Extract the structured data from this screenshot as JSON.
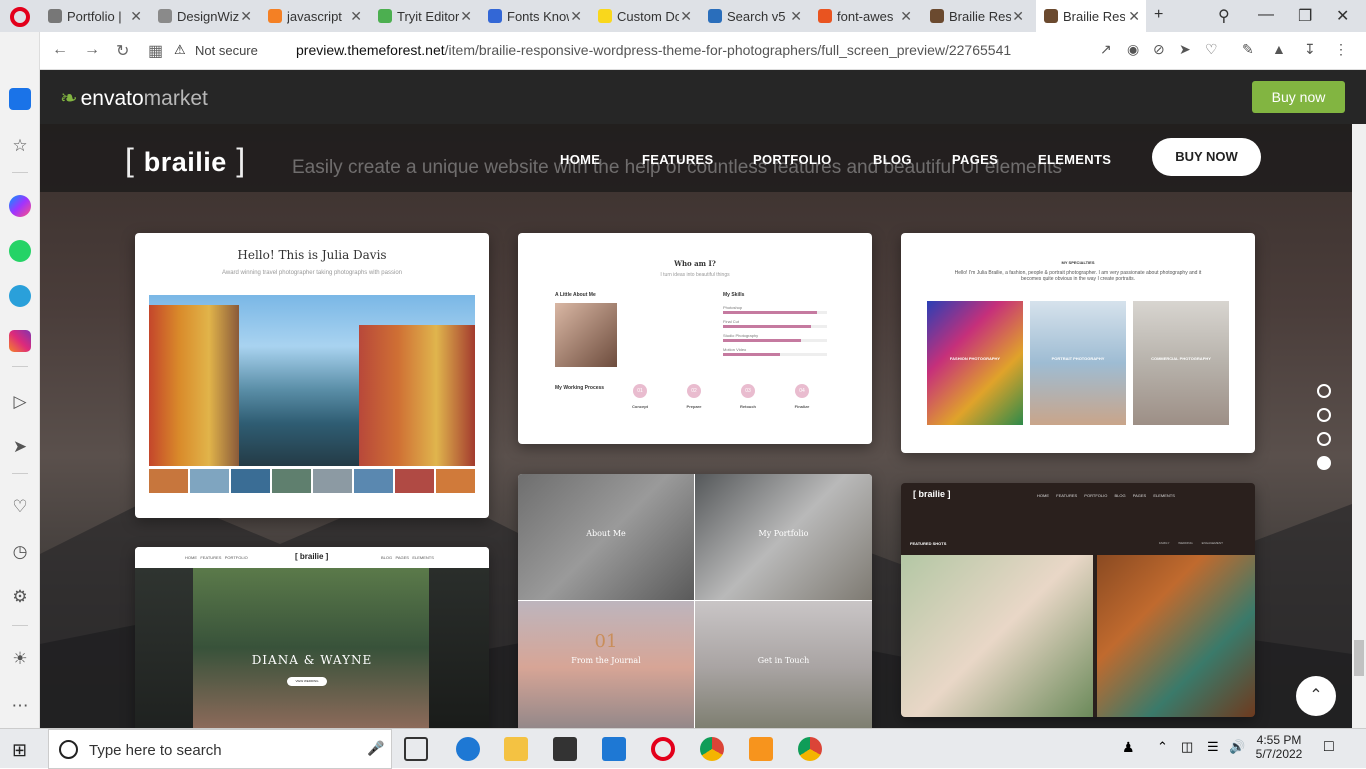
{
  "browser": {
    "tabs": [
      {
        "label": "Portfolio |",
        "color": "#777"
      },
      {
        "label": "DesignWiz",
        "color": "#8a8a8a"
      },
      {
        "label": "javascript",
        "color": "#f48024"
      },
      {
        "label": "Tryit Editor",
        "color": "#4caf50"
      },
      {
        "label": "Fonts Know",
        "color": "#3367d6"
      },
      {
        "label": "Custom Do",
        "color": "#f9d71c"
      },
      {
        "label": "Search v5",
        "color": "#2a6ebb"
      },
      {
        "label": "font-awes",
        "color": "#e95420"
      },
      {
        "label": "Brailie Resp",
        "color": "#6b4a2f"
      },
      {
        "label": "Brailie Res",
        "color": "#6b4a2f",
        "active": true
      }
    ],
    "new_tab": "+",
    "not_secure": "Not secure",
    "url_domain": "preview.themeforest.net",
    "url_path": "/item/brailie-responsive-wordpress-theme-for-photographers/full_screen_preview/22765541"
  },
  "envato": {
    "logo_envato": "envato",
    "logo_market": "market",
    "buy_now": "Buy now",
    "accent": "#82b541"
  },
  "site": {
    "brand": "brailie",
    "tagline": "Easily create a unique website with the help of countless features and beautiful UI elements",
    "menu": [
      "HOME",
      "FEATURES",
      "PORTFOLIO",
      "BLOG",
      "PAGES",
      "ELEMENTS"
    ],
    "buy_button": "BUY NOW"
  },
  "cards": {
    "c1": {
      "title": "Hello! This is Julia Davis",
      "subtitle": "Award winning travel photographer taking photographs with passion"
    },
    "c2": {
      "title": "Who am I?",
      "subtitle": "I turn ideas into beautiful things",
      "little_about": "A Little About Me",
      "skills": "My Skills",
      "skill_list": [
        "Photoshop",
        "Final Cut",
        "Studio Photography",
        "Motion Video"
      ],
      "skill_values": [
        90,
        85,
        75,
        55
      ],
      "process": "My Working Process",
      "steps": [
        "01",
        "02",
        "03",
        "04"
      ],
      "step_labels": [
        "Concept",
        "Prepare",
        "Retouch",
        "Finalize"
      ]
    },
    "c3": {
      "heading": "MY SPECIALTIES",
      "intro": "Hello! I'm Julia Brailie, a fashion, people & portrait photographer. I am very passionate about photography and it becomes quite obvious in the way I create portraits.",
      "items": [
        "FASHION PHOTOGRAPHY",
        "PORTRAIT PHOTOGRAPHY",
        "COMMERCIAL PHOTOGRAPHY"
      ]
    },
    "c4": {
      "brand": "[ brailie ]",
      "menu_left": [
        "HOME",
        "FEATURES",
        "PORTFOLIO"
      ],
      "menu_right": [
        "BLOG",
        "PAGES",
        "ELEMENTS"
      ],
      "names": "DIANA & WAYNE",
      "button": "VIEW WEDDING"
    },
    "c5": {
      "tiles": [
        "About Me",
        "My Portfolio",
        "From the Journal",
        "Get in Touch"
      ],
      "journal_num": "01"
    },
    "c6": {
      "brand": "[ brailie ]",
      "menu": [
        "HOME",
        "FEATURES",
        "PORTFOLIO",
        "BLOG",
        "PAGES",
        "ELEMENTS"
      ],
      "featured": "FEATURED SHOTS",
      "filters": [
        "FAMILY",
        "WEDDING",
        "ENGAGEMENT"
      ]
    }
  },
  "taskbar": {
    "search_placeholder": "Type here to search",
    "time": "4:55 PM",
    "date": "5/7/2022"
  }
}
